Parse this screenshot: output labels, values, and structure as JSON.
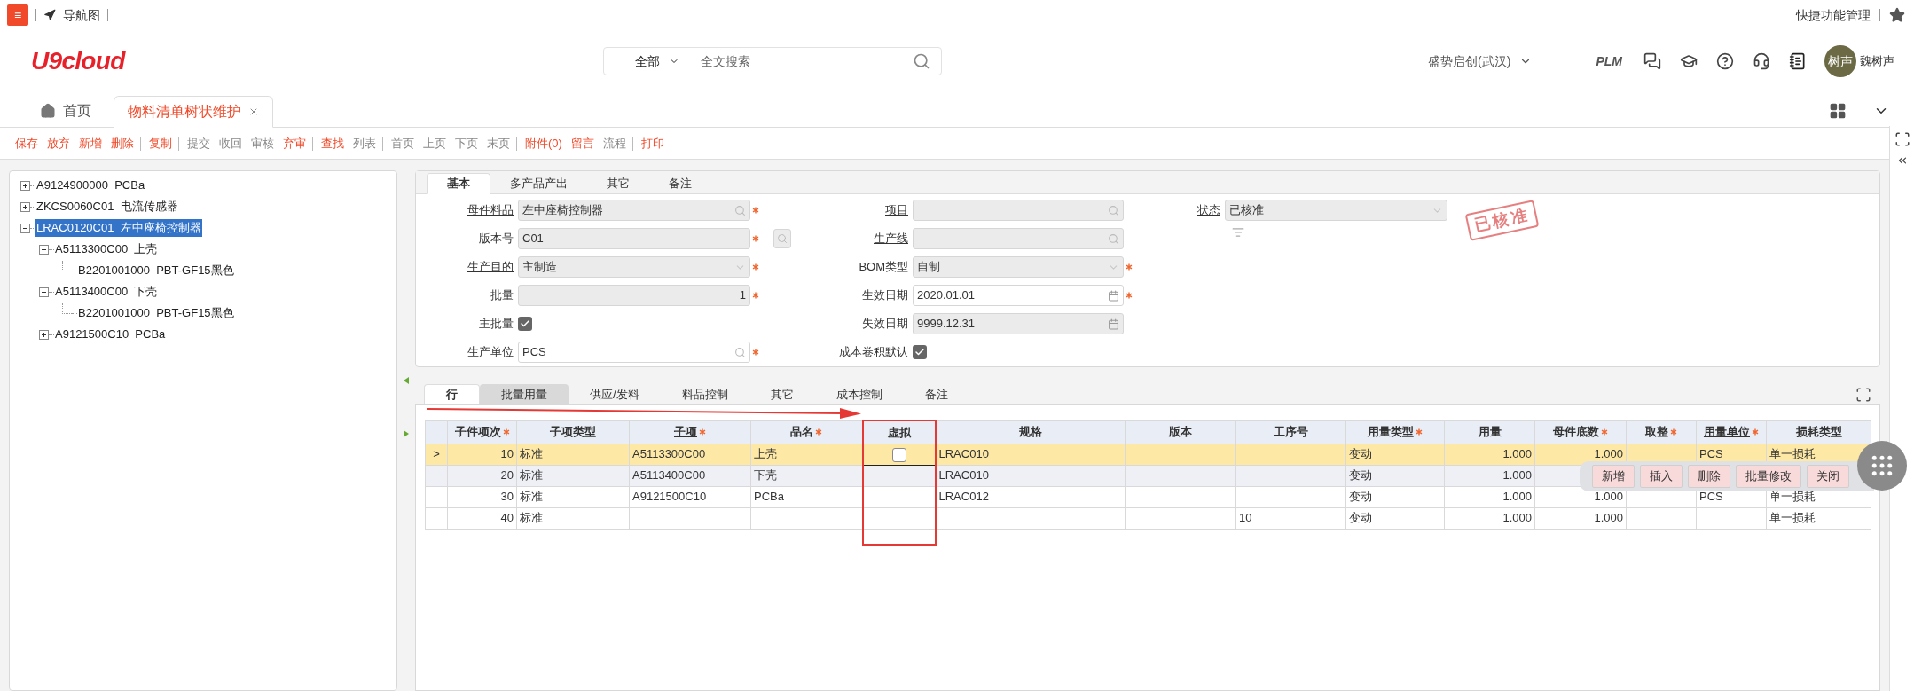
{
  "topbar": {
    "menu_glyph": "≡",
    "nav_label": "导航图",
    "quick_link": "快捷功能管理"
  },
  "header": {
    "logo": "U9cloud",
    "search": {
      "scope": "全部",
      "placeholder": "全文搜索"
    },
    "org": "盛势启创(武汉)",
    "plm": "PLM",
    "avatar_text": "树声",
    "user": "魏树声"
  },
  "page_tabs": [
    {
      "label": "首页",
      "kind": "home",
      "selected": false
    },
    {
      "label": "物料清单树状维护",
      "kind": "closable",
      "selected": true
    }
  ],
  "toolbar": [
    {
      "label": "保存",
      "disabled": false,
      "separator_after": false
    },
    {
      "label": "放弃",
      "disabled": false,
      "separator_after": false
    },
    {
      "label": "新增",
      "disabled": false,
      "separator_after": false
    },
    {
      "label": "删除",
      "disabled": false,
      "separator_after": true
    },
    {
      "label": "复制",
      "disabled": false,
      "separator_after": true
    },
    {
      "label": "提交",
      "disabled": true,
      "separator_after": false
    },
    {
      "label": "收回",
      "disabled": true,
      "separator_after": false
    },
    {
      "label": "审核",
      "disabled": true,
      "separator_after": false
    },
    {
      "label": "弃审",
      "disabled": false,
      "separator_after": true
    },
    {
      "label": "查找",
      "disabled": false,
      "separator_after": false
    },
    {
      "label": "列表",
      "disabled": true,
      "separator_after": true
    },
    {
      "label": "首页",
      "disabled": true,
      "separator_after": false
    },
    {
      "label": "上页",
      "disabled": true,
      "separator_after": false
    },
    {
      "label": "下页",
      "disabled": true,
      "separator_after": false
    },
    {
      "label": "末页",
      "disabled": true,
      "separator_after": true
    },
    {
      "label": "附件(0)",
      "disabled": false,
      "separator_after": false
    },
    {
      "label": "留言",
      "disabled": false,
      "separator_after": false
    },
    {
      "label": "流程",
      "disabled": true,
      "separator_after": true
    },
    {
      "label": "打印",
      "disabled": false,
      "separator_after": false
    }
  ],
  "tree": [
    {
      "label": "A9124900000  PCBa",
      "expanded": false,
      "selected": false
    },
    {
      "label": "ZKCS0060C01  电流传感器",
      "expanded": false,
      "selected": false
    },
    {
      "label": "LRAC0120C01  左中座椅控制器",
      "expanded": true,
      "selected": true,
      "children": [
        {
          "label": "A5113300C00  上壳",
          "expanded": true,
          "selected": false,
          "children": [
            {
              "label": "B2201001000  PBT-GF15黑色",
              "selected": false
            }
          ]
        },
        {
          "label": "A5113400C00  下壳",
          "expanded": true,
          "selected": false,
          "children": [
            {
              "label": "B2201001000  PBT-GF15黑色",
              "selected": false
            }
          ]
        },
        {
          "label": "A9121500C10  PCBa",
          "expanded": false,
          "selected": false
        }
      ]
    }
  ],
  "form": {
    "tabs": [
      {
        "label": "基本",
        "selected": true
      },
      {
        "label": "多产品产出",
        "selected": false
      },
      {
        "label": "其它",
        "selected": false
      },
      {
        "label": "备注",
        "selected": false
      }
    ],
    "columns": [
      [
        {
          "label": "母件料品",
          "link": true,
          "kind": "search",
          "value": "左中座椅控制器",
          "required": true,
          "editable": false
        },
        {
          "label": "版本号",
          "link": false,
          "kind": "text",
          "value": "C01",
          "required": true,
          "editable": false,
          "lookup_button": true
        },
        {
          "label": "生产目的",
          "link": true,
          "kind": "select",
          "value": "主制造",
          "required": true,
          "editable": false
        },
        {
          "label": "批量",
          "link": false,
          "kind": "number",
          "value": "1",
          "required": true,
          "editable": false
        },
        {
          "label": "主批量",
          "link": false,
          "kind": "checkbox",
          "checked": true
        },
        {
          "label": "生产单位",
          "link": true,
          "kind": "search",
          "value": "PCS",
          "required": true,
          "editable": true
        }
      ],
      [
        {
          "label": "项目",
          "link": true,
          "kind": "search",
          "required": false,
          "editable": false
        },
        {
          "label": "生产线",
          "link": true,
          "kind": "search",
          "required": false,
          "editable": false
        },
        {
          "label": "BOM类型",
          "link": false,
          "kind": "select",
          "value": "自制",
          "required": true,
          "editable": false
        },
        {
          "label": "生效日期",
          "link": false,
          "kind": "date",
          "value": "2020.01.01",
          "required": true,
          "editable": true
        },
        {
          "label": "失效日期",
          "link": false,
          "kind": "date",
          "value": "9999.12.31",
          "required": false,
          "editable": false
        },
        {
          "label": "成本卷积默认",
          "link": false,
          "kind": "checkbox",
          "checked": true
        }
      ],
      [
        {
          "label": "状态",
          "link": true,
          "kind": "select",
          "value": "已核准",
          "required": false,
          "editable": false
        }
      ]
    ],
    "stamp": "已核准"
  },
  "grid": {
    "tabs": [
      {
        "label": "行",
        "selected": true,
        "hovered": false
      },
      {
        "label": "批量用量",
        "selected": false,
        "hovered": true
      },
      {
        "label": "供应/发料",
        "selected": false,
        "hovered": false
      },
      {
        "label": "料品控制",
        "selected": false,
        "hovered": false
      },
      {
        "label": "其它",
        "selected": false,
        "hovered": false
      },
      {
        "label": "成本控制",
        "selected": false,
        "hovered": false
      },
      {
        "label": "备注",
        "selected": false,
        "hovered": false
      }
    ],
    "columns": [
      {
        "label": "子件项次",
        "required": true,
        "link": false,
        "kind": "number"
      },
      {
        "label": "子项类型",
        "required": false,
        "link": false,
        "kind": "text"
      },
      {
        "label": "子项",
        "required": true,
        "link": true,
        "kind": "text"
      },
      {
        "label": "品名",
        "required": true,
        "link": false,
        "kind": "text"
      },
      {
        "label": "虚拟",
        "required": false,
        "link": false,
        "kind": "checkbox"
      },
      {
        "label": "规格",
        "required": false,
        "link": false,
        "kind": "text"
      },
      {
        "label": "版本",
        "required": false,
        "link": false,
        "kind": "text"
      },
      {
        "label": "工序号",
        "required": false,
        "link": false,
        "kind": "text"
      },
      {
        "label": "用量类型",
        "required": true,
        "link": false,
        "kind": "text"
      },
      {
        "label": "用量",
        "required": false,
        "link": false,
        "kind": "number"
      },
      {
        "label": "母件底数",
        "required": true,
        "link": false,
        "kind": "number"
      },
      {
        "label": "取整",
        "required": true,
        "link": false,
        "kind": "text"
      },
      {
        "label": "用量单位",
        "required": true,
        "link": true,
        "kind": "text"
      },
      {
        "label": "损耗类型",
        "required": false,
        "link": false,
        "kind": "text"
      }
    ],
    "rows": [
      {
        "marker": ">",
        "selected": true,
        "hovered": false,
        "cells": [
          "10",
          "标准",
          "A5113300C00",
          "上壳",
          {
            "checked": false
          },
          "LRAC010",
          null,
          null,
          "变动",
          "1.000",
          "1.000",
          null,
          "PCS",
          "单一损耗"
        ]
      },
      {
        "selected": false,
        "hovered": true,
        "cells": [
          "20",
          "标准",
          "A5113400C00",
          "下壳",
          null,
          "LRAC010",
          null,
          null,
          "变动",
          "1.000",
          null,
          null,
          null,
          null
        ]
      },
      {
        "selected": false,
        "hovered": false,
        "cells": [
          "30",
          "标准",
          "A9121500C10",
          "PCBa",
          null,
          "LRAC012",
          null,
          null,
          "变动",
          "1.000",
          "1.000",
          null,
          "PCS",
          "单一损耗"
        ]
      },
      {
        "selected": false,
        "hovered": false,
        "cells": [
          "40",
          "标准",
          null,
          null,
          null,
          null,
          null,
          "10",
          "变动",
          "1.000",
          "1.000",
          null,
          null,
          "单一损耗"
        ]
      }
    ],
    "row_actions": [
      "新增",
      "插入",
      "删除",
      "批量修改",
      "关闭"
    ]
  }
}
